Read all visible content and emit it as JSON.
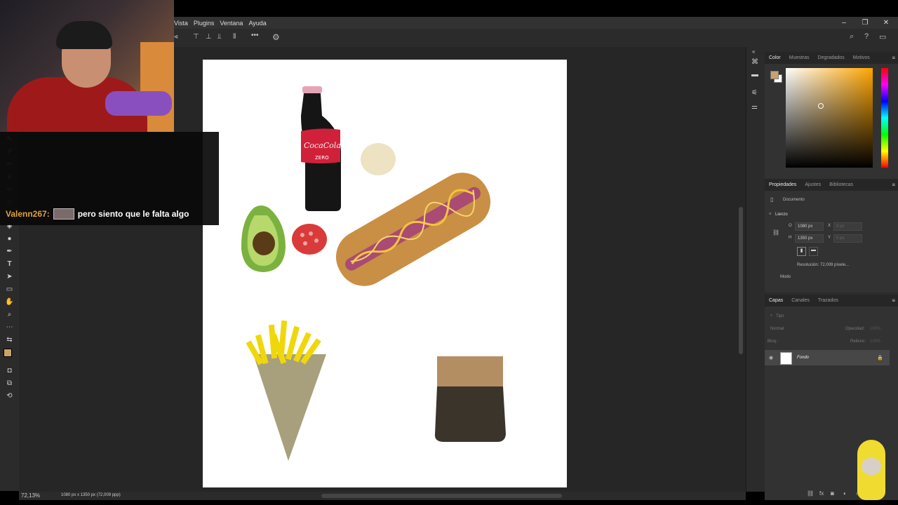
{
  "menu": {
    "items": [
      "Vista",
      "Plugins",
      "Ventana",
      "Ayuda"
    ]
  },
  "window_controls": {
    "minimize": "–",
    "restore": "❐",
    "close": "✕"
  },
  "chat": {
    "username": "Valenn267:",
    "message": "pero siento que le falta algo"
  },
  "canvas": {
    "illustrations": [
      "cola-bottle",
      "onion-slice",
      "hotdog",
      "avocado",
      "tomato-slice",
      "fries",
      "paper-bag"
    ],
    "bottle_label": "CocaCola",
    "bottle_sublabel": "ZERO"
  },
  "color_panel": {
    "tabs": [
      "Color",
      "Muestras",
      "Degradados",
      "Motivos"
    ],
    "active_tab": "Color",
    "foreground": "#c9a36a",
    "background": "#ffffff"
  },
  "properties_panel": {
    "tabs": [
      "Propiedades",
      "Ajustes",
      "Bibliotecas"
    ],
    "active_tab": "Propiedades",
    "document_label": "Documento",
    "section": "Lienzo",
    "width_label": "O",
    "width": "1080 px",
    "height_label": "H",
    "height": "1350 px",
    "x_label": "X",
    "x_placeholder": "0 px",
    "y_label": "Y",
    "y_placeholder": "0 px",
    "resolution": "Resolución: 72,009 píxele...",
    "mode_label": "Modo"
  },
  "layers_panel": {
    "tabs": [
      "Capas",
      "Canales",
      "Trazados"
    ],
    "active_tab": "Capas",
    "search_placeholder": "Tipo",
    "blend_mode": "Normal",
    "opacity_label": "Opacidad:",
    "opacity": "100%",
    "lock_label": "Bloq.:",
    "fill_label": "Relleno:",
    "fill": "100%",
    "layers": [
      {
        "name": "Fondo",
        "visible": true,
        "locked": true
      }
    ]
  },
  "status": {
    "zoom": "72,13%",
    "doc_info": "1080 px x 1350 px (72,009 ppp)"
  }
}
